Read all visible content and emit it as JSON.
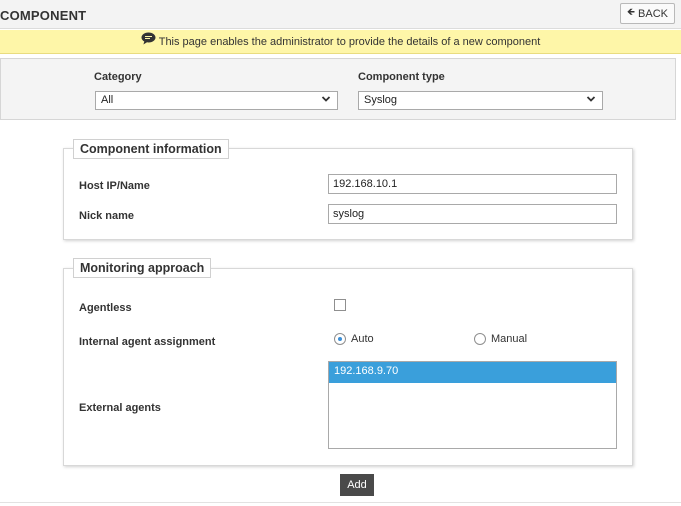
{
  "header": {
    "title": "COMPONENT",
    "back_label": "BACK"
  },
  "info": {
    "message": "This page enables the administrator to provide the details of a new component"
  },
  "filters": {
    "category_label": "Category",
    "category_value": "All",
    "component_type_label": "Component type",
    "component_type_value": "Syslog"
  },
  "component_information": {
    "legend": "Component information",
    "host_label": "Host IP/Name",
    "host_value": "192.168.10.1",
    "nick_label": "Nick name",
    "nick_value": "syslog"
  },
  "monitoring_approach": {
    "legend": "Monitoring approach",
    "agentless_label": "Agentless",
    "agentless_checked": false,
    "internal_agent_label": "Internal agent assignment",
    "radio_auto_label": "Auto",
    "radio_manual_label": "Manual",
    "selected_assignment": "Auto",
    "external_agents_label": "External agents",
    "external_agents": [
      "192.168.9.70"
    ]
  },
  "actions": {
    "add_label": "Add"
  },
  "colors": {
    "info_bar": "#fef6a8",
    "selected_option": "#3a9fdb",
    "add_button": "#4a4a4a",
    "radio_dot": "#3d8fd6"
  }
}
